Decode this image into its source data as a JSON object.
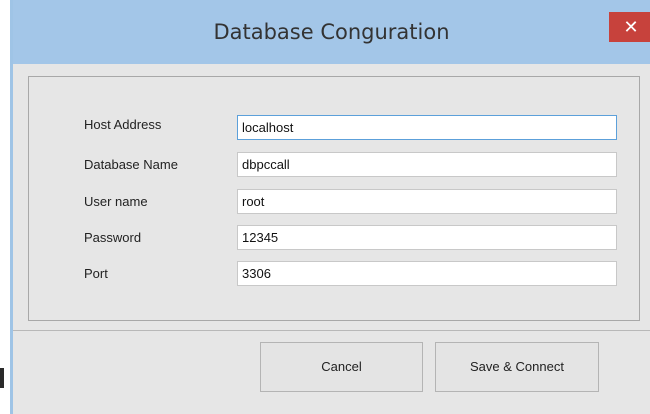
{
  "window": {
    "title": "Database Conguration",
    "close_glyph": "✕"
  },
  "form": {
    "fields": [
      {
        "label": "Host Address",
        "value": "localhost"
      },
      {
        "label": "Database Name",
        "value": "dbpccall"
      },
      {
        "label": "User name",
        "value": "root"
      },
      {
        "label": "Password",
        "value": "12345"
      },
      {
        "label": "Port",
        "value": "3306"
      }
    ]
  },
  "buttons": {
    "cancel_label": "Cancel",
    "save_label": "Save & Connect"
  },
  "colors": {
    "titlebar": "#a3c6e8",
    "close_button": "#c7423c",
    "focus_border": "#5ca0da"
  },
  "icons": {
    "close": "close-icon"
  }
}
